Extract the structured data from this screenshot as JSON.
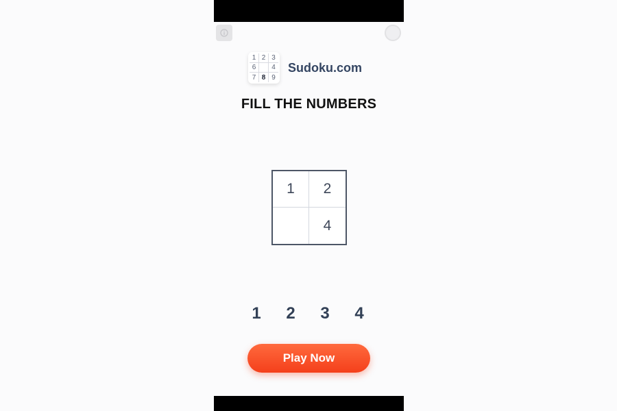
{
  "brand": {
    "name": "Sudoku.com",
    "logo_digits": [
      "1",
      "2",
      "3",
      "6",
      "",
      "4",
      "7",
      "8",
      "9"
    ]
  },
  "headline": "FILL THE NUMBERS",
  "puzzle": {
    "cells": [
      "1",
      "2",
      "",
      "4"
    ]
  },
  "number_pad": [
    "1",
    "2",
    "3",
    "4"
  ],
  "cta": {
    "label": "Play Now"
  },
  "colors": {
    "cta": "#f4401b",
    "text_dark": "#324056",
    "brand_text": "#344562"
  },
  "icons": {
    "ad_left": "ad-info-icon",
    "ad_right": "close-icon"
  }
}
